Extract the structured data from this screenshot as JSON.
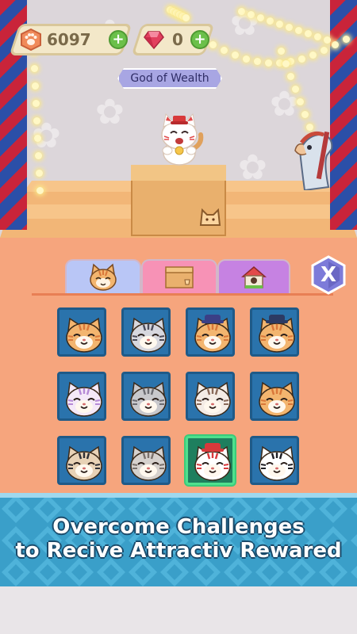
{
  "hud": {
    "coins": {
      "value": "6097",
      "icon": "paw-coin-icon"
    },
    "gems": {
      "value": "0",
      "icon": "ruby-gem-icon"
    },
    "add_label": "+"
  },
  "stage": {
    "title": "God of Wealth"
  },
  "tabs": [
    {
      "id": "cats",
      "icon": "cat-face-icon",
      "active": true
    },
    {
      "id": "items",
      "icon": "box-icon",
      "active": false
    },
    {
      "id": "houses",
      "icon": "house-icon",
      "active": false
    }
  ],
  "close_label": "X",
  "cats": [
    {
      "id": "tabby-orange",
      "fur": "#f3b56f",
      "stripe": "#d9773a"
    },
    {
      "id": "raccoon",
      "fur": "#d7d7de",
      "stripe": "#4c4c5a"
    },
    {
      "id": "police-cat",
      "fur": "#f3b56f",
      "stripe": "#d9773a",
      "hat": "#3b3f86"
    },
    {
      "id": "captain-cat",
      "fur": "#f3b56f",
      "stripe": "#d9773a",
      "hat": "#2c3a63"
    },
    {
      "id": "purple-cat",
      "fur": "#f5e9f8",
      "stripe": "#b68ad6"
    },
    {
      "id": "grey-cat",
      "fur": "#c8c8cc",
      "stripe": "#6c6c72"
    },
    {
      "id": "siamese-cat",
      "fur": "#f4ece6",
      "stripe": "#8a6a5a"
    },
    {
      "id": "tabby-orange-2",
      "fur": "#f3b56f",
      "stripe": "#d9773a"
    },
    {
      "id": "black-cape-cat",
      "fur": "#e8d2b6",
      "stripe": "#2f2f36"
    },
    {
      "id": "grey-tabby",
      "fur": "#d6d1cd",
      "stripe": "#7a716c"
    },
    {
      "id": "fortune-cat",
      "fur": "#ffffff",
      "stripe": "#d8393b",
      "hat": "#d8393b",
      "selected": true
    },
    {
      "id": "tuxedo-cat",
      "fur": "#ffffff",
      "stripe": "#1f1f25"
    }
  ],
  "promo": {
    "line1": "Overcome Challenges",
    "line2": "to Recive Attractiv Rewared"
  },
  "colors": {
    "panel": "#f6a57d",
    "slot": "#2a73ac",
    "selected_border": "#4fe08d",
    "banner": "#3a9fc9"
  }
}
